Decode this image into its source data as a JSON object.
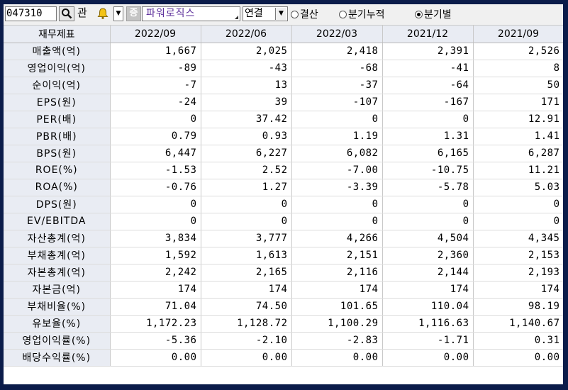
{
  "toolbar": {
    "code": "047310",
    "kwan_label": "관",
    "bell_label": "🔔",
    "jeong_label": "증",
    "company_name": "파워로직스",
    "consolidation": "연결",
    "radios": [
      {
        "label": "결산",
        "checked": false
      },
      {
        "label": "분기누적",
        "checked": false
      },
      {
        "label": "분기별",
        "checked": true
      }
    ]
  },
  "table": {
    "corner": "재무제표",
    "periods": [
      "2022/09",
      "2022/06",
      "2022/03",
      "2021/12",
      "2021/09"
    ],
    "rows": [
      {
        "label": "매출액(억)",
        "values": [
          "1,667",
          "2,025",
          "2,418",
          "2,391",
          "2,526"
        ]
      },
      {
        "label": "영업이익(억)",
        "values": [
          "-89",
          "-43",
          "-68",
          "-41",
          "8"
        ]
      },
      {
        "label": "순이익(억)",
        "values": [
          "-7",
          "13",
          "-37",
          "-64",
          "50"
        ]
      },
      {
        "label": "EPS(원)",
        "values": [
          "-24",
          "39",
          "-107",
          "-167",
          "171"
        ]
      },
      {
        "label": "PER(배)",
        "values": [
          "0",
          "37.42",
          "0",
          "0",
          "12.91"
        ]
      },
      {
        "label": "PBR(배)",
        "values": [
          "0.79",
          "0.93",
          "1.19",
          "1.31",
          "1.41"
        ]
      },
      {
        "label": "BPS(원)",
        "values": [
          "6,447",
          "6,227",
          "6,082",
          "6,165",
          "6,287"
        ]
      },
      {
        "label": "ROE(%)",
        "values": [
          "-1.53",
          "2.52",
          "-7.00",
          "-10.75",
          "11.21"
        ]
      },
      {
        "label": "ROA(%)",
        "values": [
          "-0.76",
          "1.27",
          "-3.39",
          "-5.78",
          "5.03"
        ]
      },
      {
        "label": "DPS(원)",
        "values": [
          "0",
          "0",
          "0",
          "0",
          "0"
        ]
      },
      {
        "label": "EV/EBITDA",
        "values": [
          "0",
          "0",
          "0",
          "0",
          "0"
        ]
      },
      {
        "label": "자산총계(억)",
        "values": [
          "3,834",
          "3,777",
          "4,266",
          "4,504",
          "4,345"
        ]
      },
      {
        "label": "부채총계(억)",
        "values": [
          "1,592",
          "1,613",
          "2,151",
          "2,360",
          "2,153"
        ]
      },
      {
        "label": "자본총계(억)",
        "values": [
          "2,242",
          "2,165",
          "2,116",
          "2,144",
          "2,193"
        ]
      },
      {
        "label": "자본금(억)",
        "values": [
          "174",
          "174",
          "174",
          "174",
          "174"
        ]
      },
      {
        "label": "부채비율(%)",
        "values": [
          "71.04",
          "74.50",
          "101.65",
          "110.04",
          "98.19"
        ]
      },
      {
        "label": "유보율(%)",
        "values": [
          "1,172.23",
          "1,128.72",
          "1,100.29",
          "1,116.63",
          "1,140.67"
        ]
      },
      {
        "label": "영업이익률(%)",
        "values": [
          "-5.36",
          "-2.10",
          "-2.83",
          "-1.71",
          "0.31"
        ]
      },
      {
        "label": "배당수익률(%)",
        "values": [
          "0.00",
          "0.00",
          "0.00",
          "0.00",
          "0.00"
        ]
      }
    ]
  }
}
